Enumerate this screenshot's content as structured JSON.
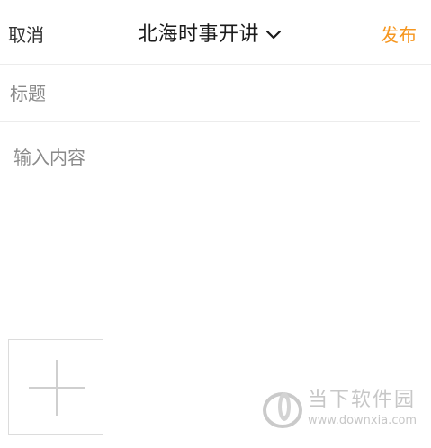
{
  "header": {
    "cancel_label": "取消",
    "title": "北海时事开讲",
    "publish_label": "发布"
  },
  "form": {
    "title_placeholder": "标题",
    "content_placeholder": "输入内容"
  },
  "watermark": {
    "name": "当下软件园",
    "url": "www.downxia.com"
  },
  "colors": {
    "accent": "#f6961e",
    "text": "#1a1a1a",
    "placeholder": "#8a8a8a",
    "divider": "#ececec"
  },
  "icons": {
    "title_dropdown": "chevron-down-icon",
    "add_image": "plus-icon",
    "watermark_logo": "downxia-logo"
  }
}
